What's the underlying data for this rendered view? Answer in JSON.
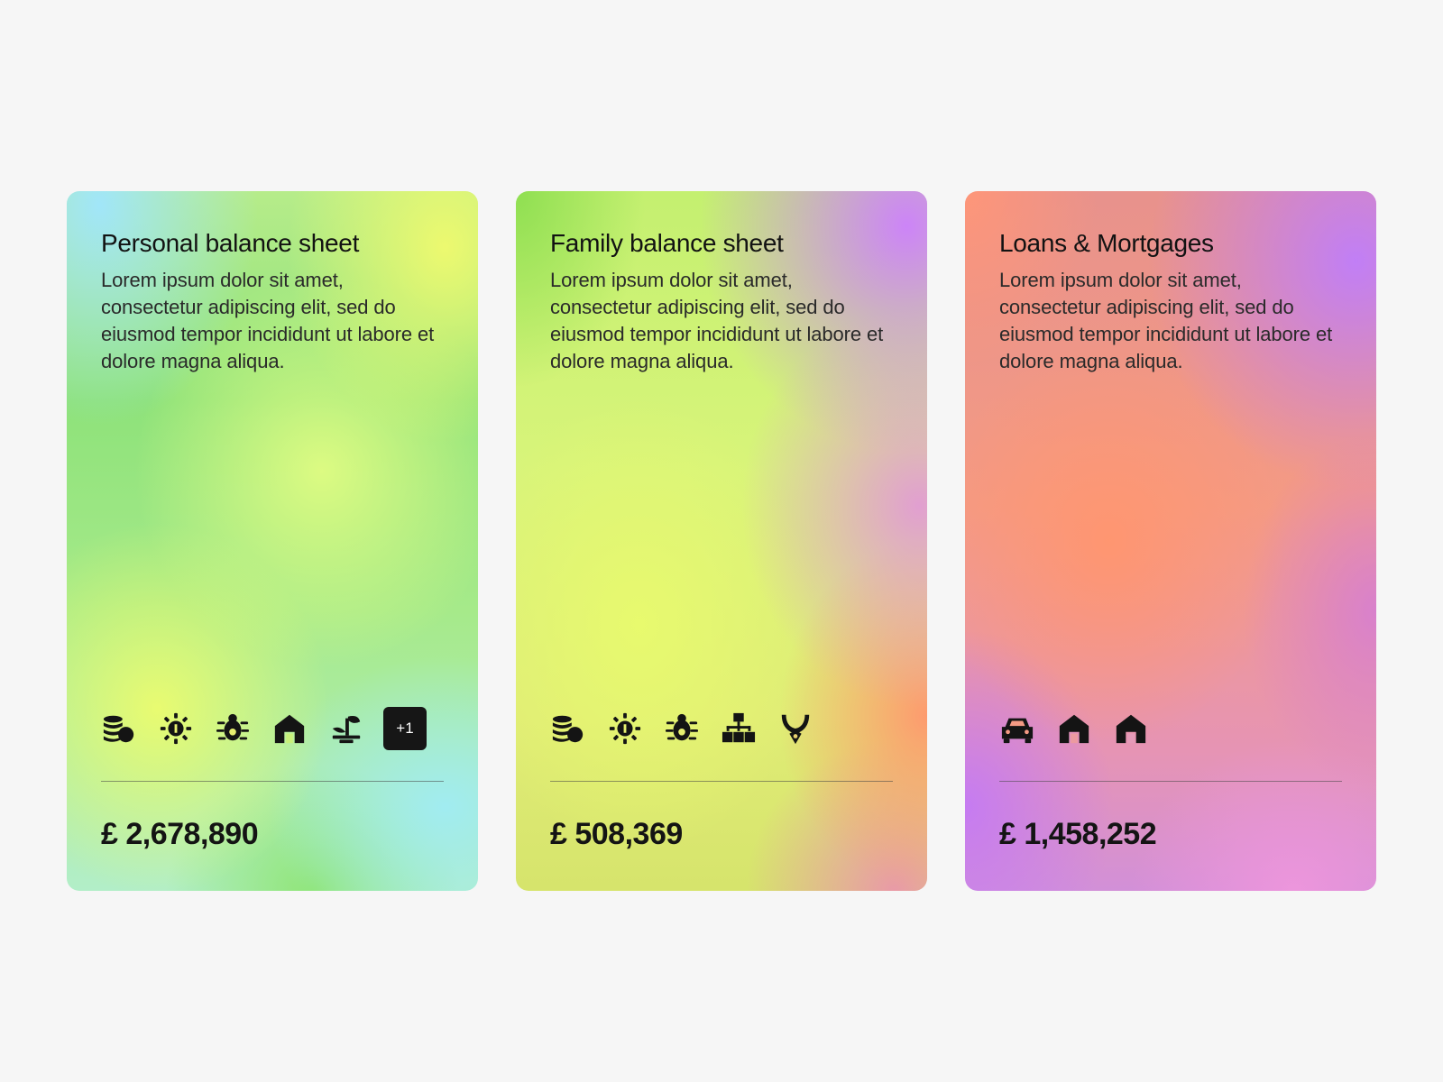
{
  "cards": [
    {
      "title": "Personal balance sheet",
      "description": "Lorem ipsum dolor sit amet, consectetur adipiscing elit, sed do eiusmod tempor incididunt ut labore et dolore magna aliqua.",
      "icons": [
        "coins-icon",
        "sun-coin-icon",
        "bug-icon",
        "house-icon",
        "sapling-icon"
      ],
      "more_count": "+1",
      "amount": "£ 2,678,890"
    },
    {
      "title": "Family balance sheet",
      "description": "Lorem ipsum dolor sit amet, consectetur adipiscing elit, sed do eiusmod tempor incididunt ut labore et dolore magna aliqua.",
      "icons": [
        "coins-icon",
        "sun-coin-icon",
        "bug-icon",
        "hierarchy-icon",
        "necklace-icon"
      ],
      "amount": "£ 508,369"
    },
    {
      "title": "Loans & Mortgages",
      "description": "Lorem ipsum dolor sit amet, consectetur adipiscing elit, sed do eiusmod tempor incididunt ut labore et dolore magna aliqua.",
      "icons": [
        "car-icon",
        "house-icon",
        "house-icon"
      ],
      "amount": "£ 1,458,252"
    }
  ],
  "colors": {
    "page_background": "#f6f6f6",
    "text": "#141414",
    "badge_background": "#161616"
  }
}
